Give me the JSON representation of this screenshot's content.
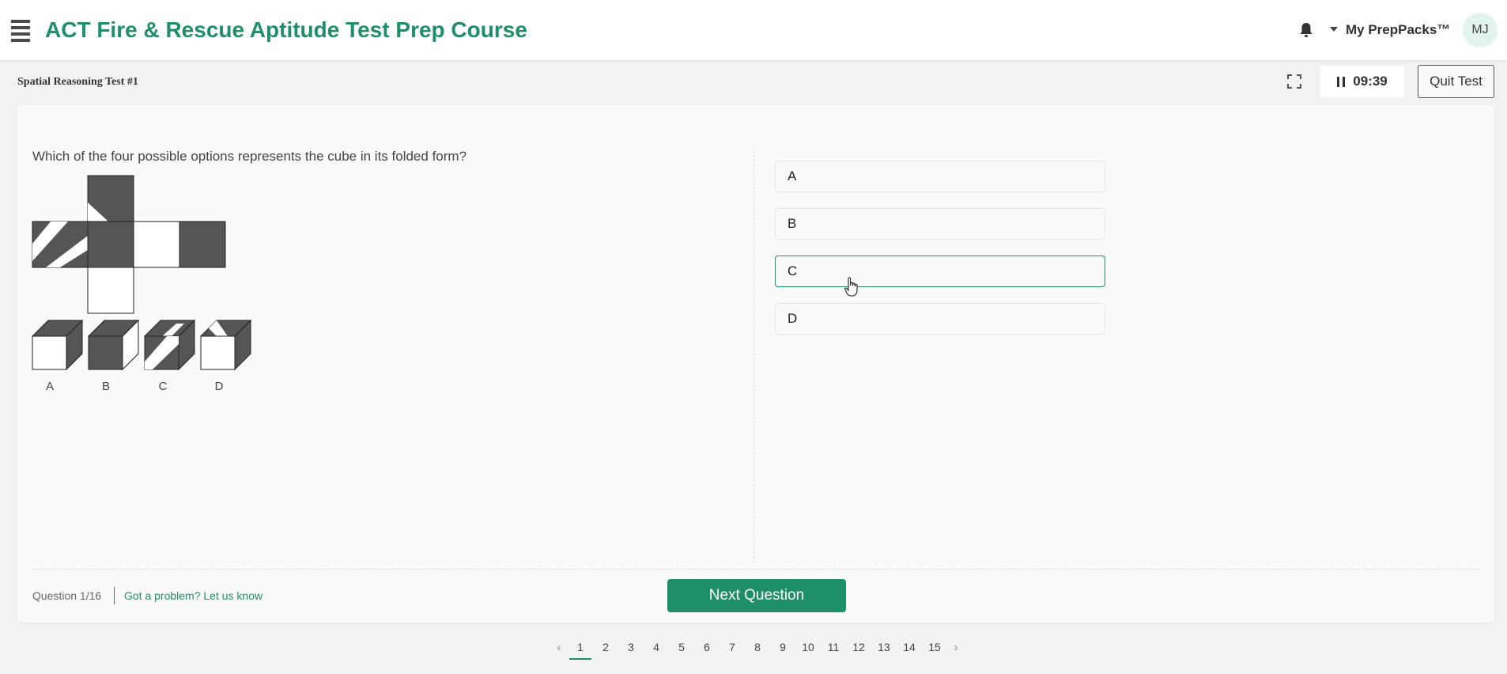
{
  "header": {
    "title": "ACT Fire & Rescue Aptitude Test Prep Course",
    "account_menu": "My PrepPacks™",
    "avatar_initials": "MJ"
  },
  "subheader": {
    "test_name": "Spatial Reasoning Test #1",
    "timer": "09:39",
    "quit_label": "Quit Test"
  },
  "question": {
    "text": "Which of the four possible options represents the cube in its folded form?",
    "figure_labels": [
      "A",
      "B",
      "C",
      "D"
    ]
  },
  "options": [
    {
      "label": "A",
      "state": "default"
    },
    {
      "label": "B",
      "state": "default"
    },
    {
      "label": "C",
      "state": "hover"
    },
    {
      "label": "D",
      "state": "default"
    }
  ],
  "footer": {
    "question_count": "Question 1/16",
    "problem_link": "Got a problem? Let us know",
    "next_label": "Next Question"
  },
  "pagination": {
    "pages": [
      "1",
      "2",
      "3",
      "4",
      "5",
      "6",
      "7",
      "8",
      "9",
      "10",
      "11",
      "12",
      "13",
      "14",
      "15"
    ],
    "active": "1"
  },
  "colors": {
    "brand": "#1f8f68",
    "face_dark": "#555555"
  }
}
